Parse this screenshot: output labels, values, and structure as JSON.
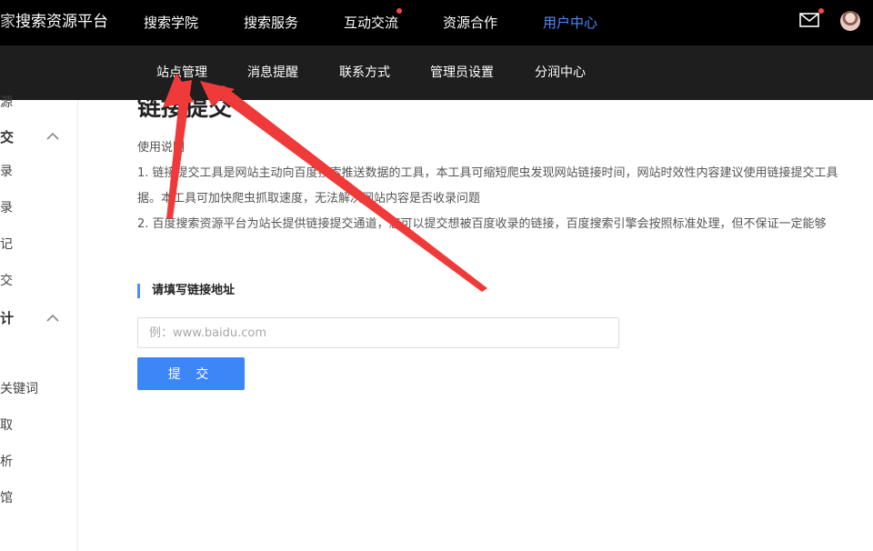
{
  "header": {
    "logo_fragment": "家",
    "logo_name": "搜索资源平台",
    "nav": [
      {
        "label": "搜索学院",
        "active": false,
        "dot": false
      },
      {
        "label": "搜索服务",
        "active": false,
        "dot": false
      },
      {
        "label": "互动交流",
        "active": false,
        "dot": true
      },
      {
        "label": "资源合作",
        "active": false,
        "dot": false
      },
      {
        "label": "用户中心",
        "active": true,
        "dot": false
      }
    ],
    "mail_icon": "mail-icon",
    "avatar_icon": "avatar"
  },
  "subnav": {
    "items": [
      {
        "label": "站点管理"
      },
      {
        "label": "消息提醒"
      },
      {
        "label": "联系方式"
      },
      {
        "label": "管理员设置"
      },
      {
        "label": "分润中心"
      }
    ]
  },
  "sidebar": {
    "items": [
      {
        "label": "源",
        "group": false
      },
      {
        "label": "交",
        "group": true,
        "chevron": "chevron-up-icon"
      },
      {
        "label": "录",
        "group": false
      },
      {
        "label": "录",
        "group": false
      },
      {
        "label": "记",
        "group": false
      },
      {
        "label": "交",
        "group": false
      },
      {
        "label": "计",
        "group": true,
        "chevron": "chevron-up-icon"
      },
      {
        "label": "关键词",
        "group": false
      },
      {
        "label": "取",
        "group": false
      },
      {
        "label": "析",
        "group": false
      },
      {
        "label": "馆",
        "group": false
      }
    ]
  },
  "main": {
    "page_title": "链接提交",
    "usage_title": "使用说明",
    "usage_lines": [
      "1. 链接提交工具是网站主动向百度搜索推送数据的工具，本工具可缩短爬虫发现网站链接时间，网站时效性内容建议使用链接提交工具",
      "据。本工具可加快爬虫抓取速度，无法解决网站内容是否收录问题",
      "2. 百度搜索资源平台为站长提供链接提交通道，您可以提交想被百度收录的链接，百度搜索引擎会按照标准处理，但不保证一定能够"
    ],
    "section_title": "请填写链接地址",
    "url_input": {
      "value": "",
      "placeholder": "例：www.baidu.com"
    },
    "submit_label": "提 交"
  },
  "colors": {
    "topbar_bg": "#000000",
    "subbar_bg": "#1e1e1e",
    "accent": "#4e8cff",
    "button": "#3d86f7",
    "notification_dot": "#f0494c",
    "annotation_arrow": "#f03a3a"
  }
}
